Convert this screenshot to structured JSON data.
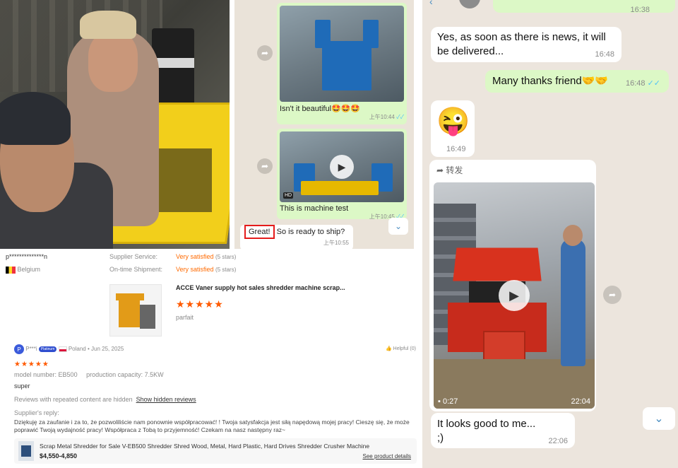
{
  "middle_chat": {
    "msg1_caption": "Isn't it beautiful",
    "msg1_emoji": "🤩🤩🤩",
    "msg1_time": "上午10:44",
    "msg2_caption": "This is machine test",
    "msg2_hd": "HD",
    "msg2_time": "上午10:45",
    "msg3_great": "Great!",
    "msg3_rest": " So is ready to ship?",
    "msg3_time": "上午10:55",
    "ticks": "✓✓"
  },
  "review": {
    "reviewer_name": "p**************n",
    "reviewer_country": "Belgium",
    "supplier_service_label": "Supplier Service:",
    "supplier_service_value": "Very satisfied",
    "supplier_service_stars": "(5 stars)",
    "ontime_label": "On-time Shipment:",
    "ontime_value": "Very satisfied",
    "ontime_stars": "(5 stars)",
    "product_title": "ACCE Vaner supply hot sales shredder machine scrap...",
    "product_rating": 5,
    "product_comment": "parfait",
    "review2_user_initial": "P",
    "review2_user": "P***i",
    "review2_badge": "Platinum",
    "review2_country": "Poland",
    "review2_date": "• Jun 25, 2025",
    "helpful": "Helpful (0)",
    "review2_rating": 5,
    "model_label": "model number:",
    "model_value": "EB500",
    "capacity_label": "production capacity:",
    "capacity_value": "7.5KW",
    "review2_comment": "super",
    "hidden_note": "Reviews with repeated content are hidden",
    "show_hidden": "Show hidden reviews",
    "supplier_reply_label": "Supplier's reply:",
    "supplier_reply_text": "Dziękuję za zaufanie i za to, że pozwoliliście nam ponownie współpracować! ! Twoja satysfakcja jest siłą napędową mojej pracy! Cieszę się, że może poprawić Twoją wydajność pracy! Współpraca z Tobą to przyjemność! Czekam na nasz następny raz~",
    "bar_product_title": "Scrap Metal Shredder for Sale V-EB500 Shredder Shred Wood, Metal, Hard Plastic, Hard Drives Shredder Crusher Machine",
    "bar_price": "$4,550-4,850",
    "see_details": "See product details"
  },
  "right_chat": {
    "top_partial_time": "16:38",
    "msg_news_text": "Yes, as soon as there is news, it will be delivered...",
    "msg_news_time": "16:48",
    "msg_thanks_text": "Many thanks friend",
    "msg_thanks_emoji": "🤝🤝",
    "msg_thanks_time": "16:48",
    "emoji_msg": "😜",
    "emoji_time": "16:49",
    "forward_label": "转发",
    "video_duration": "0:27",
    "video_time": "22:04",
    "msg_good_text": "It looks good to me...",
    "msg_good_text2": ";)",
    "msg_good_time": "22:06",
    "ticks": "✓✓"
  },
  "colors": {
    "outgoing_bubble": "#dcf8c6",
    "chat_bg": "#ece5dd",
    "star_orange": "#ff5a00",
    "highlight_red": "#e41b1b",
    "machine_blue": "#1f6bb8",
    "machine_red": "#d8321e"
  }
}
